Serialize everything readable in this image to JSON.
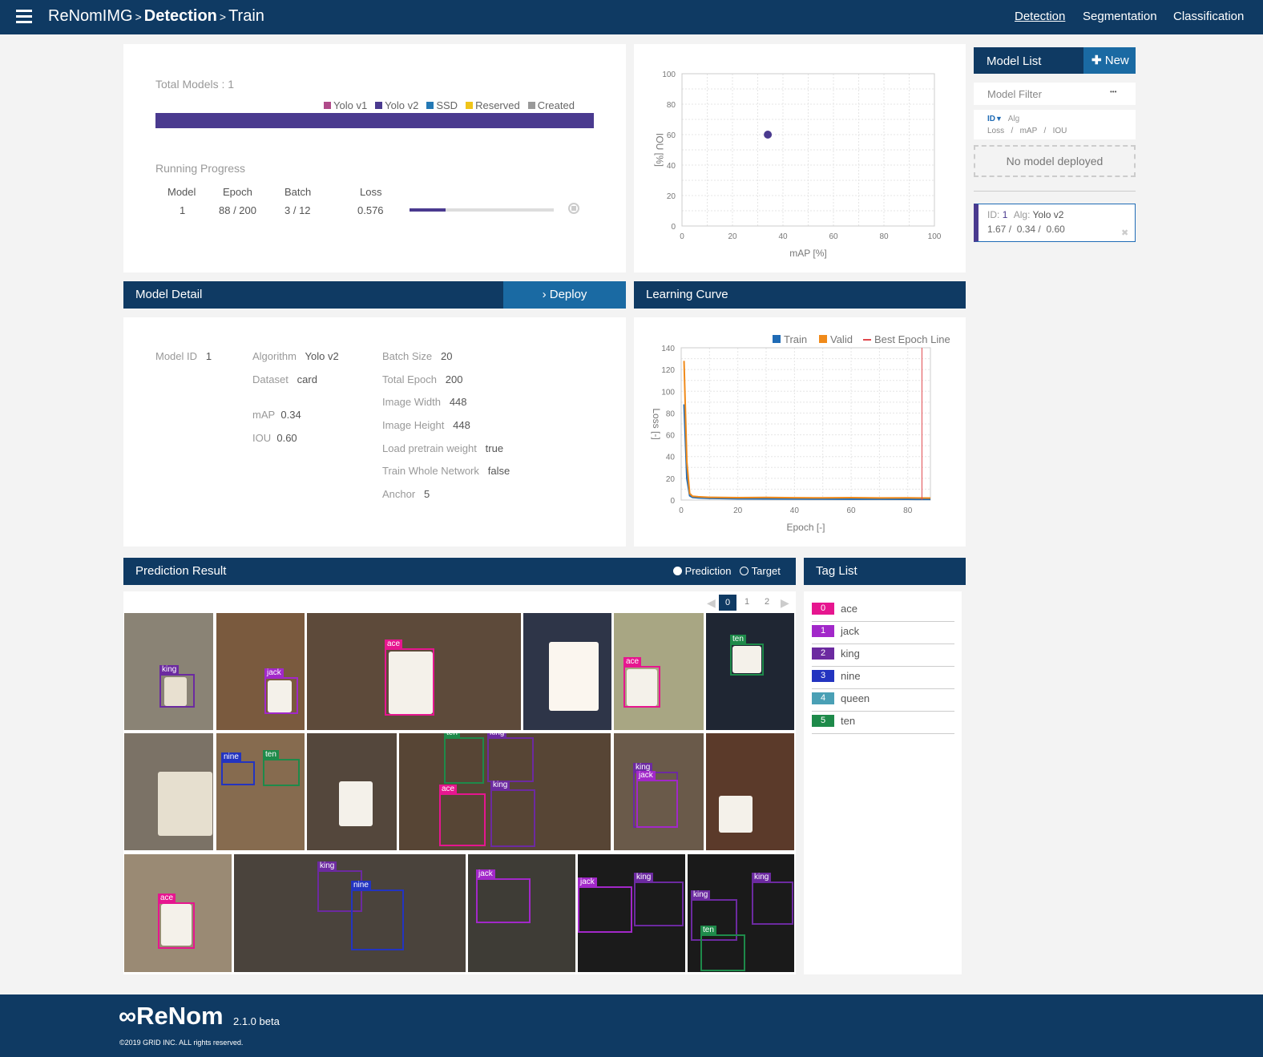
{
  "header": {
    "app": "ReNomIMG",
    "sep1": ">",
    "section": "Detection",
    "sep2": ">",
    "page": "Train",
    "nav": {
      "detection": "Detection",
      "segmentation": "Segmentation",
      "classification": "Classification"
    }
  },
  "summary": {
    "total_models": "Total Models : 1",
    "legend": {
      "yolo1": "Yolo v1",
      "yolo2": "Yolo v2",
      "ssd": "SSD",
      "reserved": "Reserved",
      "created": "Created"
    },
    "progress_title": "Running Progress",
    "col_model": "Model",
    "col_epoch": "Epoch",
    "col_batch": "Batch",
    "col_loss": "Loss",
    "val_model": "1",
    "val_epoch": "88 / 200",
    "val_batch": "3 / 12",
    "val_loss": "0.576",
    "batch_progress": 0.25
  },
  "colors": {
    "navy": "#0f3a63",
    "yolo1": "#b04a8a",
    "yolo2": "#4a3a8f",
    "ssd": "#2479b5",
    "reserved": "#f0c419",
    "created": "#999999",
    "train": "#1f6bb5",
    "valid": "#f08a1a",
    "best": "#e0474c"
  },
  "scatter": {
    "type": "scatter",
    "xlabel": "mAP [%]",
    "ylabel": "IOU [%]",
    "xlim": [
      0,
      100
    ],
    "ylim": [
      0,
      100
    ],
    "xticks": [
      "0",
      "20",
      "40",
      "60",
      "80",
      "100"
    ],
    "yticks": [
      "0",
      "20",
      "40",
      "60",
      "80",
      "100"
    ],
    "points": [
      {
        "x": 34,
        "y": 60
      }
    ]
  },
  "model_list": {
    "title": "Model List",
    "new_label": "New",
    "filter_label": "Model Filter",
    "filter_dots": "•••",
    "sort_id": "ID",
    "sort_alg": "Alg",
    "sort_loss": "Loss",
    "slash1": "/",
    "sort_map": "mAP",
    "slash2": "/",
    "sort_iou": "IOU",
    "deployed": "No model deployed",
    "item": {
      "id_label": "ID:",
      "id": "1",
      "alg_label": "Alg:",
      "alg": "Yolo v2",
      "loss": "1.67",
      "s1": "/",
      "map": "0.34",
      "s2": "/",
      "iou": "0.60",
      "close": "✖"
    }
  },
  "detail": {
    "title": "Model Detail",
    "deploy": "Deploy",
    "model_id_label": "Model ID",
    "model_id": "1",
    "algorithm_label": "Algorithm",
    "algorithm": "Yolo v2",
    "dataset_label": "Dataset",
    "dataset": "card",
    "map_label": "mAP",
    "map": "0.34",
    "iou_label": "IOU",
    "iou": "0.60",
    "batch_label": "Batch Size",
    "batch": "20",
    "epoch_label": "Total Epoch",
    "epoch": "200",
    "width_label": "Image Width",
    "width": "448",
    "height_label": "Image Height",
    "height": "448",
    "pretrain_label": "Load pretrain weight",
    "pretrain": "true",
    "whole_label": "Train Whole Network",
    "whole": "false",
    "anchor_label": "Anchor",
    "anchor": "5"
  },
  "learning_curve": {
    "title": "Learning Curve",
    "chart_data": {
      "type": "line",
      "xlabel": "Epoch [-]",
      "ylabel": "Loss [-]",
      "xlim": [
        0,
        88
      ],
      "ylim": [
        0,
        140
      ],
      "xticks": [
        "0",
        "20",
        "40",
        "60",
        "80"
      ],
      "yticks": [
        "0",
        "20",
        "40",
        "60",
        "80",
        "100",
        "120",
        "140"
      ],
      "legend": {
        "train": "Train",
        "valid": "Valid",
        "best": "Best Epoch Line"
      },
      "best_epoch": 85,
      "series": [
        {
          "name": "Train",
          "x": [
            1,
            2,
            3,
            4,
            6,
            10,
            20,
            30,
            40,
            50,
            60,
            70,
            80,
            88
          ],
          "values": [
            88,
            20,
            4,
            2.5,
            2,
            1.6,
            1.2,
            1.1,
            1.0,
            0.9,
            0.8,
            0.8,
            0.7,
            0.6
          ]
        },
        {
          "name": "Valid",
          "x": [
            1,
            2,
            3,
            4,
            6,
            10,
            20,
            30,
            40,
            50,
            60,
            70,
            80,
            88
          ],
          "values": [
            128,
            35,
            6,
            3.5,
            3,
            2.5,
            2.2,
            2.4,
            2.1,
            2.0,
            2.2,
            1.9,
            2.0,
            1.8
          ]
        }
      ]
    }
  },
  "prediction": {
    "title": "Prediction Result",
    "opt_prediction": "Prediction",
    "opt_target": "Target",
    "pages": [
      "0",
      "1",
      "2"
    ]
  },
  "tags": {
    "title": "Tag List",
    "items": [
      {
        "num": "0",
        "name": "ace",
        "color": "#e6168f"
      },
      {
        "num": "1",
        "name": "jack",
        "color": "#a228c9"
      },
      {
        "num": "2",
        "name": "king",
        "color": "#6c2aa0"
      },
      {
        "num": "3",
        "name": "nine",
        "color": "#2334c0"
      },
      {
        "num": "4",
        "name": "queen",
        "color": "#4aa0b5"
      },
      {
        "num": "5",
        "name": "ten",
        "color": "#1e8a4a"
      }
    ]
  },
  "footer": {
    "logo": "∞ReNom",
    "version": "2.1.0 beta",
    "copyright": "©2019 GRID INC. ALL rights reserved."
  }
}
